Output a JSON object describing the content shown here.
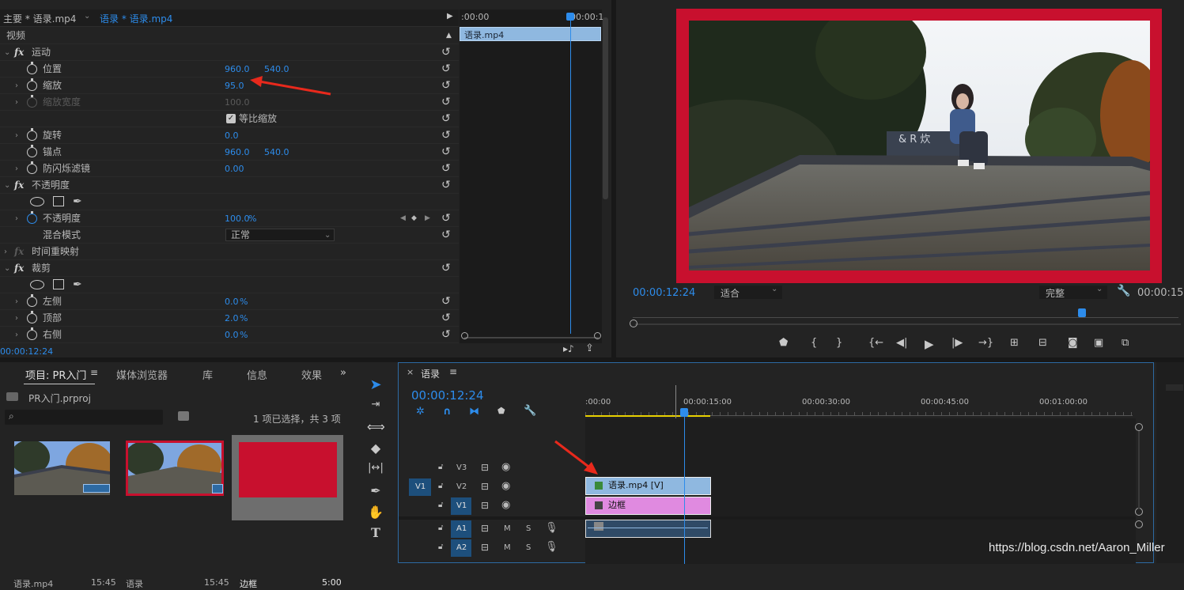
{
  "effects": {
    "tab_master": "主要 * 语录.mp4",
    "tab_clip": "语录 * 语录.mp4",
    "section_video": "视频",
    "motion": "运动",
    "position": {
      "label": "位置",
      "x": "960.0",
      "y": "540.0"
    },
    "scale": {
      "label": "缩放",
      "value": "95.0"
    },
    "scale_width": {
      "label": "缩放宽度",
      "value": "100.0"
    },
    "uniform_scale": "等比缩放",
    "rotation": {
      "label": "旋转",
      "value": "0.0"
    },
    "anchor": {
      "label": "锚点",
      "x": "960.0",
      "y": "540.0"
    },
    "antiflicker": {
      "label": "防闪烁滤镜",
      "value": "0.00"
    },
    "opacity_group": "不透明度",
    "opacity": {
      "label": "不透明度",
      "value": "100.0",
      "unit": "%"
    },
    "blend": {
      "label": "混合模式",
      "value": "正常"
    },
    "time_remap": "时间重映射",
    "crop": "裁剪",
    "crop_left": {
      "label": "左侧",
      "value": "0.0",
      "unit": "%"
    },
    "crop_top": {
      "label": "顶部",
      "value": "2.0",
      "unit": "%"
    },
    "crop_right": {
      "label": "右侧",
      "value": "0.0",
      "unit": "%"
    },
    "timecode": "00:00:12:24"
  },
  "ec_timeline": {
    "start": ":00:00",
    "end": "00:00:1",
    "clip": "语录.mp4"
  },
  "program": {
    "timecode": "00:00:12:24",
    "fit": "适合",
    "quality": "完整",
    "duration": "00:00:15:"
  },
  "project": {
    "tab_project": "项目: PR入门",
    "tab_media": "媒体浏览器",
    "tab_library": "库",
    "tab_info": "信息",
    "tab_effects": "效果",
    "project_file": "PR入门.prproj",
    "selection": "1 项已选择，共 3 项",
    "items": [
      {
        "name": "语录.mp4",
        "duration": "15:45"
      },
      {
        "name": "语录",
        "duration": "15:45"
      },
      {
        "name": "边框",
        "duration": "5:00"
      }
    ]
  },
  "timeline": {
    "title": "语录",
    "timecode": "00:00:12:24",
    "ruler": [
      ":00:00",
      "00:00:15:00",
      "00:00:30:00",
      "00:00:45:00",
      "00:01:00:00"
    ],
    "tracks": {
      "v3": "V3",
      "v2": "V2",
      "v1": "V1",
      "a1": "A1",
      "a2": "A2",
      "src_v1": "V1",
      "m": "M",
      "s": "S"
    },
    "clip_video": "语录.mp4 [V]",
    "clip_frame": "边框"
  },
  "watermark": "https://blog.csdn.net/Aaron_Miller",
  "colors": {
    "accent": "#2d8ceb",
    "frame_red": "#c8102e",
    "clip_blue": "#8fb8e0",
    "clip_pink": "#e08ae0"
  }
}
